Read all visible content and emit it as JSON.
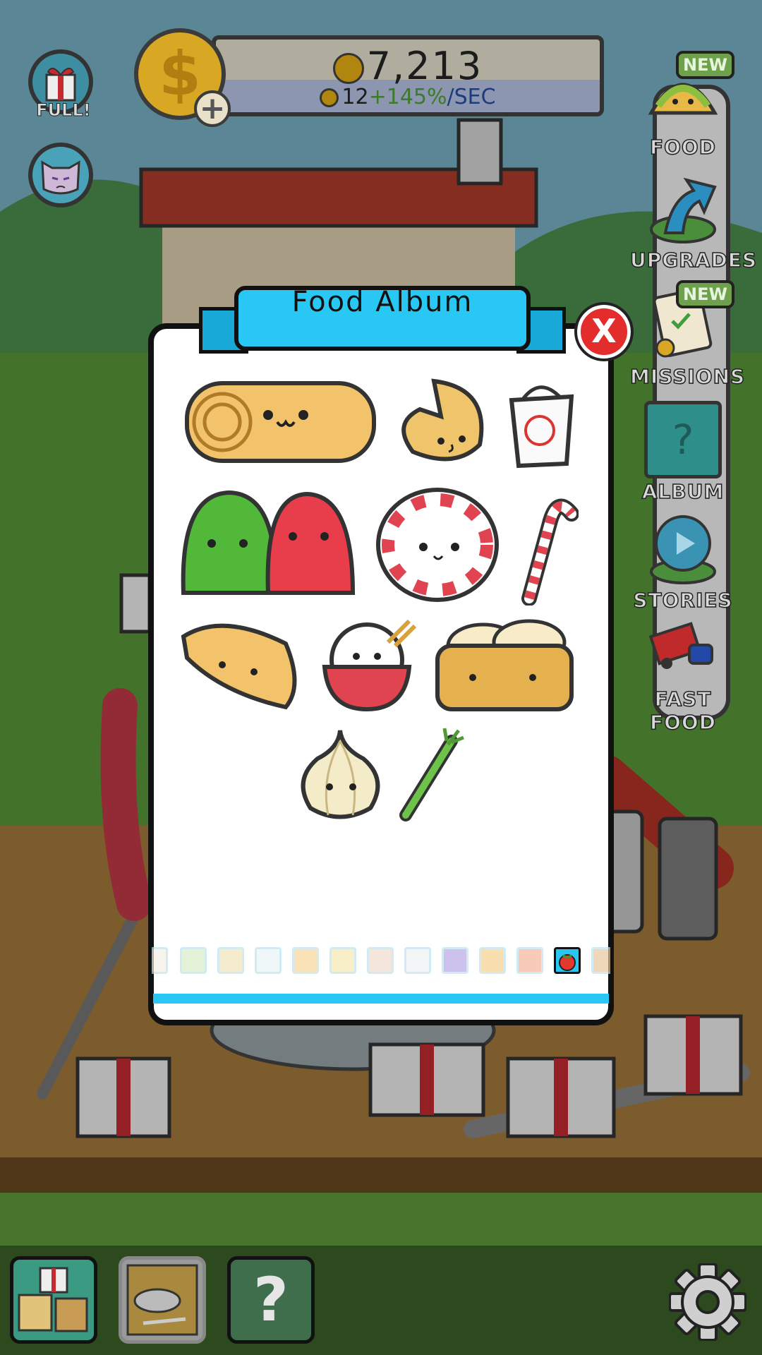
{
  "header": {
    "coin_total": "7,213",
    "rate_base": "12",
    "rate_bonus": "+145%",
    "rate_unit": "/SEC",
    "coin_symbol": "$",
    "coin_plus": "+"
  },
  "left_buttons": {
    "gift_status": "FULL!"
  },
  "side_menu": {
    "items": [
      {
        "label": "FOOD",
        "badge": "NEW",
        "icon": "taco-icon"
      },
      {
        "label": "UPGRADES",
        "badge": "",
        "icon": "up-arrow-icon"
      },
      {
        "label": "MISSIONS",
        "badge": "NEW",
        "icon": "clipboard-icon"
      },
      {
        "label": "ALBUM",
        "badge": "",
        "icon": "book-question-icon"
      },
      {
        "label": "STORIES",
        "badge": "",
        "icon": "play-bubble-icon"
      },
      {
        "label": "FAST FOOD",
        "badge": "",
        "icon": "truck-icon"
      }
    ]
  },
  "album": {
    "title": "Food Album",
    "close_label": "X",
    "foods": [
      "egg-roll",
      "fortune-cookie",
      "takeout-box",
      "gumdrops",
      "peppermint-candy",
      "candy-cane",
      "dumpling",
      "rice-bowl",
      "dim-sum-basket",
      "onion",
      "green-onion"
    ],
    "page_count": 13,
    "active_page": 12
  },
  "colors": {
    "accent": "#29c8f4",
    "close": "#e32c2c",
    "badge_green": "#6fa14d",
    "bonus_green": "#3d7a2a",
    "unit_blue": "#1e3c7c"
  },
  "bottom_bar": {
    "buttons": [
      "gift-boxes-icon",
      "plate-icon",
      "mystery-map-icon"
    ],
    "settings_icon": "gear-icon",
    "mystery_label": "?"
  }
}
